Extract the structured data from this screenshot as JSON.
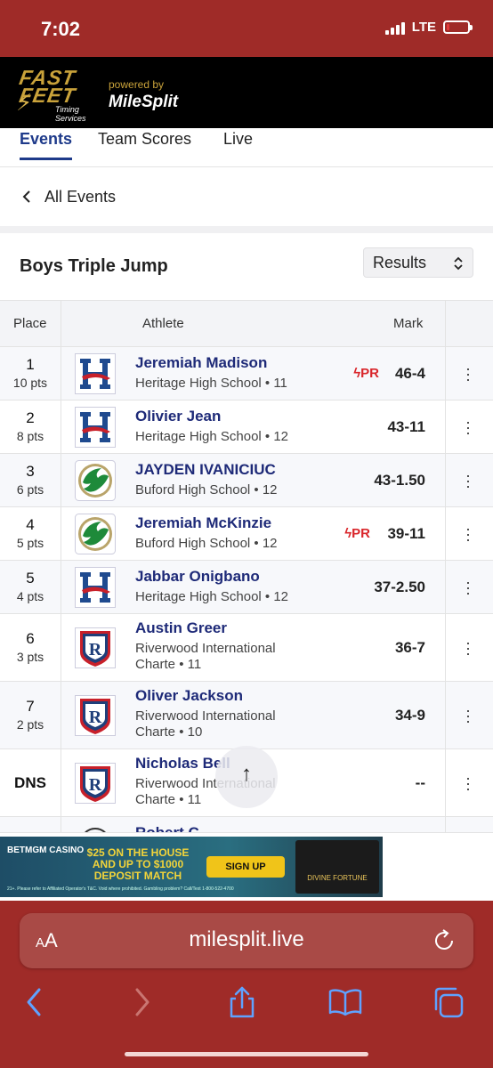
{
  "status_bar": {
    "time": "7:02",
    "network": "LTE",
    "battery_level": 0.15
  },
  "brand": {
    "logo_line1": "FAST",
    "logo_line2": "FEET",
    "logo_sub": "Timing Services",
    "powered_by": "powered by",
    "partner": "MileSplit"
  },
  "tabs": [
    {
      "label": "Events",
      "active": true
    },
    {
      "label": "Team Scores",
      "active": false
    },
    {
      "label": "Live",
      "active": false
    }
  ],
  "back": {
    "label": "All Events"
  },
  "event": {
    "title": "Boys Triple Jump",
    "view_select": "Results"
  },
  "table": {
    "headers": {
      "place": "Place",
      "athlete": "Athlete",
      "mark": "Mark"
    },
    "rows": [
      {
        "place": "1",
        "pts": "10 pts",
        "name": "Jeremiah Madison",
        "school": "Heritage High School • 11",
        "mark": "46-4",
        "pr": "PR",
        "logo": "heritage-logo"
      },
      {
        "place": "2",
        "pts": "8 pts",
        "name": "Olivier Jean",
        "school": "Heritage High School • 12",
        "mark": "43-11",
        "pr": "",
        "logo": "heritage-logo"
      },
      {
        "place": "3",
        "pts": "6 pts",
        "name": "JAYDEN IVANICIUC",
        "school": "Buford High School • 12",
        "mark": "43-1.50",
        "pr": "",
        "logo": "buford-logo"
      },
      {
        "place": "4",
        "pts": "5 pts",
        "name": "Jeremiah McKinzie",
        "school": "Buford High School • 12",
        "mark": "39-11",
        "pr": "PR",
        "logo": "buford-logo"
      },
      {
        "place": "5",
        "pts": "4 pts",
        "name": "Jabbar Onigbano",
        "school": "Heritage High School • 12",
        "mark": "37-2.50",
        "pr": "",
        "logo": "heritage-logo"
      },
      {
        "place": "6",
        "pts": "3 pts",
        "name": "Austin Greer",
        "school_line1": "Riverwood International",
        "school_line2": "Charte • 11",
        "mark": "36-7",
        "pr": "",
        "logo": "riverwood-logo"
      },
      {
        "place": "7",
        "pts": "2 pts",
        "name": "Oliver Jackson",
        "school_line1": "Riverwood International",
        "school_line2": "Charte • 10",
        "mark": "34-9",
        "pr": "",
        "logo": "riverwood-logo"
      },
      {
        "place": "DNS",
        "pts": "",
        "name": "Nicholas Bell",
        "school_line1": "Riverwood International",
        "school_line2": "Charte • 11",
        "mark": "--",
        "pr": "",
        "logo": "riverwood-logo"
      },
      {
        "place": "",
        "pts": "",
        "name": "Robert C",
        "school": "",
        "mark": "",
        "pr": "",
        "logo": "generic-logo"
      }
    ]
  },
  "ad": {
    "brand": "BETMGM CASINO",
    "offer": "$25 ON THE HOUSE AND UP TO $1000 DEPOSIT MATCH",
    "cta": "SIGN UP",
    "game": "DIVINE FORTUNE",
    "fine_print": "21+. Please refer to Affiliated Operator's T&C. Void where prohibited. Gambling problem? Call/Text 1-800-522-4700"
  },
  "browser": {
    "aa_label": "AA",
    "url": "milesplit.live"
  },
  "colors": {
    "accent": "#1e3a8a",
    "pr_red": "#d9262b",
    "browser_bar": "#9f2b28",
    "brand_gold": "#c9a23a"
  }
}
